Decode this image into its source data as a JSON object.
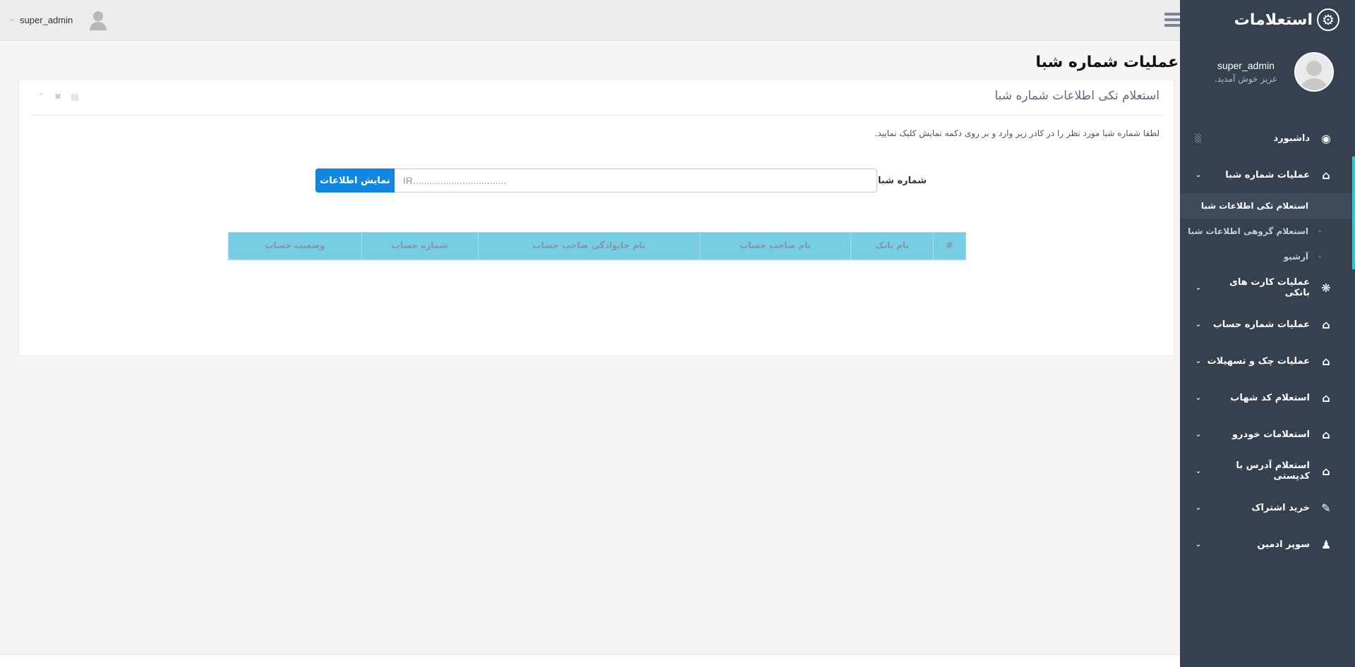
{
  "sidebar": {
    "brand_title": "استعلامات",
    "brand_icon": "gear-icon",
    "username": "super_admin",
    "welcome": "عزیز خوش آمدید.",
    "dashboard_label": "داشبورد",
    "open_group": {
      "label": "عملیات شماره شبا",
      "items": [
        {
          "label": "استعلام تکی اطلاعات شبا",
          "active": true
        },
        {
          "label": "استعلام گروهی اطلاعات شبا",
          "active": false
        },
        {
          "label": "آرشیو",
          "active": false
        }
      ]
    },
    "items": [
      {
        "label": "عملیات کارت های بانکی",
        "icon": "bug-icon"
      },
      {
        "label": "عملیات شماره حساب",
        "icon": "home-icon"
      },
      {
        "label": "عملیات چک و تسهیلات",
        "icon": "home-icon"
      },
      {
        "label": "استعلام کد شهاب",
        "icon": "home-icon"
      },
      {
        "label": "استعلامات خودرو",
        "icon": "home-icon"
      },
      {
        "label": "استعلام آدرس با کدپستی",
        "icon": "home-icon"
      },
      {
        "label": "خرید اشتراک",
        "icon": "edit-icon"
      },
      {
        "label": "سوپر ادمین",
        "icon": "user-icon"
      }
    ],
    "accent_color": "#36c6d3",
    "bg_color": "#364150"
  },
  "topbar": {
    "username": "super_admin"
  },
  "page": {
    "title": "عملیات شماره شبا",
    "portlet_title": "استعلام تکی اطلاعات شماره شبا",
    "hint": "لطفا شماره شبا مورد نظر را در کادر زیر وارد و بر روی دکمه نمایش کلیک نمایید.",
    "field_label": "شماره شبا:",
    "input_placeholder": "IR..................................",
    "input_value": "",
    "button_label": "نمایش اطلاعات",
    "button_color": "#1188e0"
  },
  "table": {
    "headers": [
      "#",
      "نام بانک",
      "نام صاحب حساب",
      "نام خانوادگی صاحب حساب",
      "شماره حساب",
      "وضعیت حساب"
    ],
    "header_color": "#77cde4",
    "rows": []
  }
}
